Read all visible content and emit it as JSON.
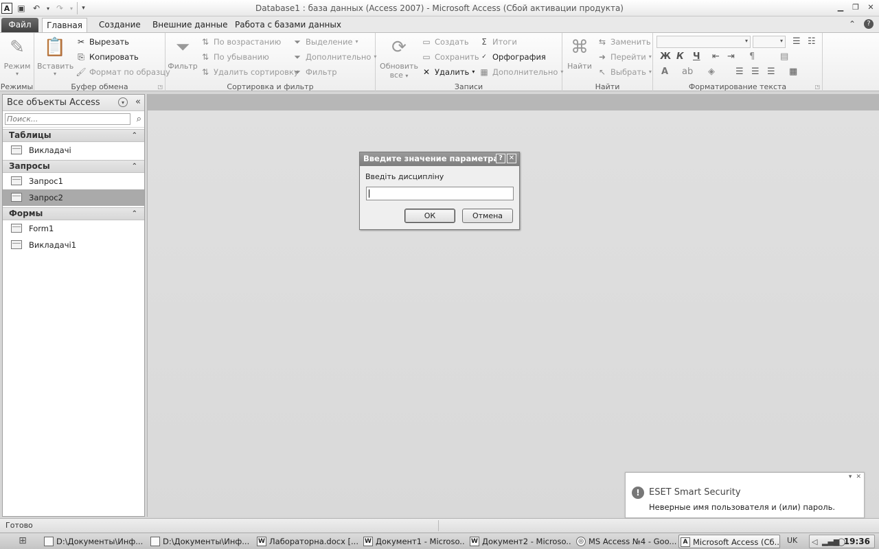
{
  "window": {
    "title": "Database1 : база данных (Access 2007)  -  Microsoft Access (Сбой активации продукта)",
    "app_logo": "A"
  },
  "tabs": {
    "file": "Файл",
    "home": "Главная",
    "create": "Создание",
    "external": "Внешние данные",
    "database": "Работа с базами данных"
  },
  "ribbon": {
    "views": {
      "label": "Режимы",
      "view": "Режим"
    },
    "clipboard": {
      "label": "Буфер обмена",
      "paste": "Вставить",
      "cut": "Вырезать",
      "copy": "Копировать",
      "format_painter": "Формат по образцу"
    },
    "sort_filter": {
      "label": "Сортировка и фильтр",
      "filter": "Фильтр",
      "ascending": "По возрастанию",
      "descending": "По убыванию",
      "remove_sort": "Удалить сортировку",
      "selection": "Выделение",
      "advanced": "Дополнительно",
      "toggle_filter": "Фильтр"
    },
    "records": {
      "label": "Записи",
      "refresh": "Обновить",
      "refresh_all": "все",
      "new": "Создать",
      "save": "Сохранить",
      "delete": "Удалить",
      "totals": "Итоги",
      "spelling": "Орфография",
      "more": "Дополнительно"
    },
    "find": {
      "label": "Найти",
      "find": "Найти",
      "replace": "Заменить",
      "goto": "Перейти",
      "select": "Выбрать"
    },
    "text_format": {
      "label": "Форматирование текста",
      "bold": "Ж",
      "italic": "К",
      "underline": "Ч",
      "font_color": "A"
    }
  },
  "nav": {
    "title": "Все объекты Access",
    "search_placeholder": "Поиск...",
    "categories": [
      {
        "label": "Таблицы",
        "items": [
          "Викладачі"
        ]
      },
      {
        "label": "Запросы",
        "items": [
          "Запрос1",
          "Запрос2"
        ]
      },
      {
        "label": "Формы",
        "items": [
          "Form1",
          "Викладачі1"
        ]
      }
    ],
    "selected_item": "Запрос2"
  },
  "dialog": {
    "title": "Введите значение параметра",
    "help": "?",
    "close": "✕",
    "prompt": "Введіть дисципліну",
    "value": "",
    "ok": "ОК",
    "cancel": "Отмена"
  },
  "notification": {
    "title": "ESET Smart Security",
    "message": "Неверные имя пользователя и (или) пароль.",
    "icon": "!"
  },
  "status": {
    "text": "Готово"
  },
  "taskbar": {
    "items": [
      {
        "label": "D:\\Документы\\Инф...",
        "icon": "folder-icon"
      },
      {
        "label": "D:\\Документы\\Инф...",
        "icon": "folder-icon"
      },
      {
        "label": "Лабораторна.docx [...",
        "icon": "word-icon",
        "glyph": "W"
      },
      {
        "label": "Документ1 - Microso...",
        "icon": "word-icon",
        "glyph": "W"
      },
      {
        "label": "Документ2 - Microso...",
        "icon": "word-icon",
        "glyph": "W"
      },
      {
        "label": "MS Access №4 - Goo...",
        "icon": "chrome-icon",
        "glyph": "◎"
      },
      {
        "label": "Microsoft Access (Сб...",
        "icon": "access-icon",
        "glyph": "A",
        "active": true
      }
    ],
    "lang": "UK",
    "clock": "19:36"
  }
}
